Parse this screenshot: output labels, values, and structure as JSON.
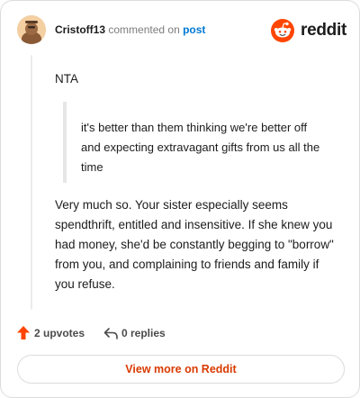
{
  "comment": {
    "username": "Cristoff13",
    "action_text": "commented on",
    "post_link_text": "post",
    "brand_name": "reddit",
    "line1": "NTA",
    "quote": "it's better than them thinking we're better off and expecting extravagant gifts from us all the time",
    "paragraph": "Very much so. Your sister especially seems spendthrift, entitled and insensitive. If she knew you had money, she'd be constantly begging to \"borrow\" from you, and complaining to friends and family if you refuse."
  },
  "actions": {
    "upvotes": "2 upvotes",
    "replies": "0 replies"
  },
  "footer": {
    "view_more": "View more on Reddit"
  },
  "colors": {
    "brand_orange": "#ff4500",
    "link_blue": "#0079d3",
    "view_more_text": "#d93a00"
  },
  "icons": {
    "avatar": "user-avatar-icon",
    "brand": "reddit-logo-icon",
    "upvote": "upvote-arrow-icon",
    "reply": "reply-arrow-icon"
  }
}
